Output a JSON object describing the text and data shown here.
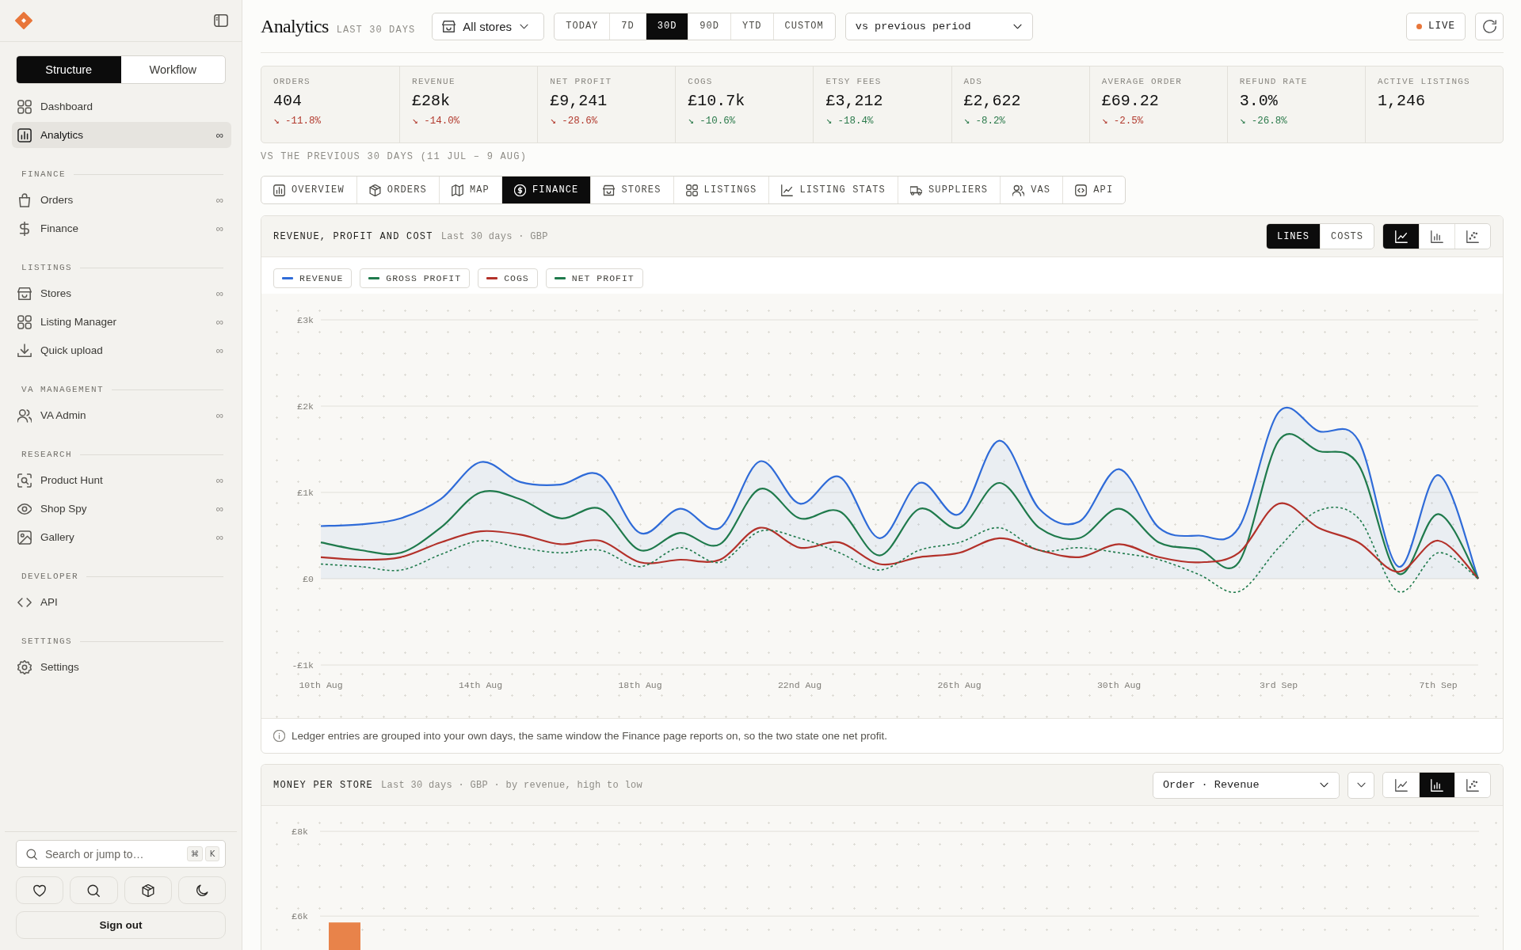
{
  "sidebar": {
    "mode_tabs": [
      {
        "label": "Structure",
        "selected": true
      },
      {
        "label": "Workflow",
        "selected": false
      }
    ],
    "sections": [
      {
        "items": [
          {
            "label": "Dashboard",
            "selected": false
          },
          {
            "label": "Analytics",
            "badge": "∞",
            "selected": true
          }
        ]
      },
      {
        "heading": "FINANCE",
        "items": [
          {
            "label": "Orders",
            "badge": "∞",
            "selected": false
          },
          {
            "label": "Finance",
            "badge": "∞",
            "selected": false
          }
        ]
      },
      {
        "heading": "LISTINGS",
        "items": [
          {
            "label": "Stores",
            "badge": "∞",
            "selected": false
          },
          {
            "label": "Listing Manager",
            "badge": "∞",
            "selected": false
          },
          {
            "label": "Quick upload",
            "badge": "∞",
            "selected": false
          }
        ]
      },
      {
        "heading": "VA MANAGEMENT",
        "items": [
          {
            "label": "VA Admin",
            "badge": "∞",
            "selected": false
          }
        ]
      },
      {
        "heading": "RESEARCH",
        "items": [
          {
            "label": "Product Hunt",
            "badge": "∞",
            "selected": false
          },
          {
            "label": "Shop Spy",
            "badge": "∞",
            "selected": false
          },
          {
            "label": "Gallery",
            "badge": "∞",
            "selected": false
          }
        ]
      },
      {
        "heading": "DEVELOPER",
        "items": [
          {
            "label": "API",
            "selected": false
          }
        ]
      },
      {
        "heading": "SETTINGS",
        "items": [
          {
            "label": "Settings",
            "selected": false
          }
        ]
      }
    ],
    "search": {
      "placeholder": "Search or jump to…",
      "keys": [
        "⌘",
        "K"
      ]
    },
    "sign_out": "Sign out"
  },
  "header": {
    "title": "Analytics",
    "subtitle": "LAST 30 DAYS",
    "store_select": "All stores",
    "ranges": [
      {
        "label": "TODAY",
        "selected": false
      },
      {
        "label": "7D",
        "selected": false
      },
      {
        "label": "30D",
        "selected": true
      },
      {
        "label": "90D",
        "selected": false
      },
      {
        "label": "YTD",
        "selected": false
      },
      {
        "label": "CUSTOM",
        "selected": false
      }
    ],
    "compare_select": "vs previous period",
    "live": {
      "label": "LIVE",
      "active": true
    }
  },
  "kpis": [
    {
      "label": "ORDERS",
      "value": "404",
      "delta": "↘ -11.8%",
      "favorable": false
    },
    {
      "label": "REVENUE",
      "value": "£28k",
      "delta": "↘ -14.0%",
      "favorable": false
    },
    {
      "label": "NET PROFIT",
      "value": "£9,241",
      "delta": "↘ -28.6%",
      "favorable": false
    },
    {
      "label": "COGS",
      "value": "£10.7k",
      "delta": "↘ -10.6%",
      "favorable": true
    },
    {
      "label": "ETSY FEES",
      "value": "£3,212",
      "delta": "↘ -18.4%",
      "favorable": true
    },
    {
      "label": "ADS",
      "value": "£2,622",
      "delta": "↘ -8.2%",
      "favorable": true
    },
    {
      "label": "AVERAGE ORDER",
      "value": "£69.22",
      "delta": "↘ -2.5%",
      "favorable": false
    },
    {
      "label": "REFUND RATE",
      "value": "3.0%",
      "delta": "↘ -26.8%",
      "favorable": true
    },
    {
      "label": "ACTIVE LISTINGS",
      "value": "1,246"
    }
  ],
  "comparison_note": "VS THE PREVIOUS 30 DAYS (11 JUL – 9 AUG)",
  "tabs": [
    {
      "label": "OVERVIEW",
      "selected": false
    },
    {
      "label": "ORDERS",
      "selected": false
    },
    {
      "label": "MAP",
      "selected": false
    },
    {
      "label": "FINANCE",
      "selected": true
    },
    {
      "label": "STORES",
      "selected": false
    },
    {
      "label": "LISTINGS",
      "selected": false
    },
    {
      "label": "LISTING STATS",
      "selected": false
    },
    {
      "label": "SUPPLIERS",
      "selected": false
    },
    {
      "label": "VAS",
      "selected": false
    },
    {
      "label": "API",
      "selected": false
    }
  ],
  "panels": [
    {
      "title": "REVENUE, PROFIT AND COST",
      "meta": "Last 30 days · GBP",
      "modes": [
        {
          "label": "LINES",
          "selected": true
        },
        {
          "label": "COSTS",
          "selected": false
        }
      ],
      "chart_types": [
        {
          "kind": "line",
          "selected": true
        },
        {
          "kind": "bar",
          "selected": false
        },
        {
          "kind": "scatter",
          "selected": false
        }
      ],
      "chart_data": {
        "type": "line",
        "grid": true,
        "categories": [
          "10th Aug",
          null,
          null,
          null,
          "14th Aug",
          null,
          null,
          null,
          "18th Aug",
          null,
          null,
          null,
          "22nd Aug",
          null,
          null,
          null,
          "26th Aug",
          null,
          null,
          null,
          "30th Aug",
          null,
          null,
          null,
          "3rd Sep",
          null,
          null,
          null,
          "7th Sep",
          null
        ],
        "ylim": [
          -1000,
          3000
        ],
        "yticks": [
          {
            "value": -1000,
            "label": "-£1k"
          },
          {
            "value": 0,
            "label": "£0"
          },
          {
            "value": 1000,
            "label": "£1k"
          },
          {
            "value": 2000,
            "label": "£2k"
          },
          {
            "value": 3000,
            "label": "£3k"
          }
        ],
        "series": [
          {
            "name": "REVENUE",
            "color": "#2f6bd8",
            "type": "area",
            "line_style": "solid",
            "values": [
              610,
              630,
              700,
              920,
              1350,
              1120,
              1090,
              1200,
              530,
              810,
              590,
              1360,
              870,
              1180,
              470,
              1110,
              750,
              1600,
              810,
              660,
              1270,
              590,
              500,
              590,
              1930,
              1710,
              1600,
              140,
              1200,
              0
            ]
          },
          {
            "name": "GROSS PROFIT",
            "color": "#1f7a4c",
            "type": "line",
            "line_style": "solid",
            "values": [
              420,
              330,
              300,
              590,
              1000,
              920,
              700,
              810,
              330,
              530,
              400,
              1040,
              700,
              780,
              270,
              810,
              590,
              1110,
              590,
              470,
              810,
              420,
              340,
              190,
              1600,
              1480,
              1320,
              60,
              750,
              0
            ]
          },
          {
            "name": "COGS",
            "color": "#b3312a",
            "type": "line",
            "line_style": "solid",
            "values": [
              250,
              220,
              250,
              420,
              550,
              510,
              400,
              440,
              190,
              220,
              220,
              590,
              360,
              420,
              170,
              250,
              300,
              470,
              330,
              250,
              400,
              250,
              190,
              300,
              870,
              590,
              420,
              80,
              440,
              0
            ]
          },
          {
            "name": "NET PROFIT",
            "color": "#1f7a4c",
            "type": "line",
            "line_style": "dashed",
            "values": [
              170,
              140,
              100,
              280,
              440,
              360,
              300,
              330,
              140,
              360,
              190,
              550,
              470,
              300,
              100,
              330,
              420,
              590,
              330,
              360,
              300,
              220,
              50,
              -150,
              360,
              790,
              700,
              -150,
              300,
              0
            ]
          }
        ]
      },
      "note": "Ledger entries are grouped into your own days, the same window the Finance page reports on, so the two state one net profit."
    },
    {
      "title": "MONEY PER STORE",
      "meta": "Last 30 days · GBP · by revenue, high to low",
      "sort_select": "Order · Revenue",
      "chart_types": [
        {
          "kind": "line",
          "selected": false
        },
        {
          "kind": "bar",
          "selected": true
        },
        {
          "kind": "scatter",
          "selected": false
        }
      ],
      "chart_data": {
        "type": "bar",
        "grid": true,
        "ylim": [
          5200,
          8600
        ],
        "yticks": [
          {
            "value": 6000,
            "label": "£6k"
          },
          {
            "value": 8000,
            "label": "£8k"
          }
        ],
        "series": [
          {
            "color": "#e8834a",
            "values": [
              5850
            ]
          }
        ]
      }
    }
  ]
}
